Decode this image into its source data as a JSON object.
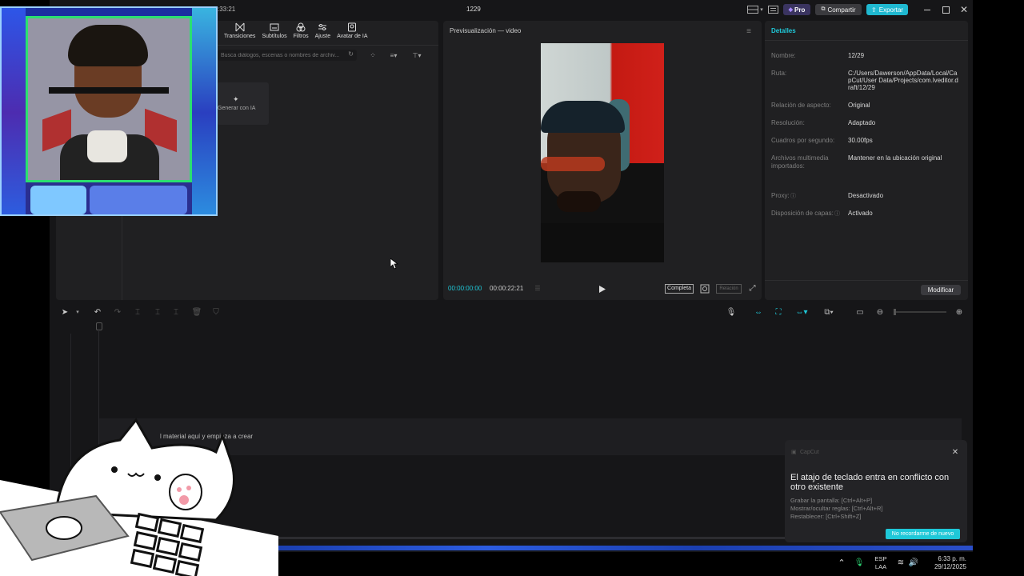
{
  "window": {
    "time_fragment": ":33:21",
    "project_name": "1229"
  },
  "titlebar": {
    "pro_label": "Pro",
    "share_label": "Compartir",
    "export_label": "Exportar"
  },
  "toolbar": {
    "items": [
      "Transiciones",
      "Subtítulos",
      "Filtros",
      "Ajuste",
      "Avatar de IA"
    ]
  },
  "media": {
    "search_placeholder": "Busca diálogos, escenas o nombres de archiv...",
    "ai_card_label": "Generar con IA"
  },
  "preview": {
    "title": "Previsualización — video",
    "current_time": "00:00:00:00",
    "total_time": "00:00:22:21",
    "complete_label": "Completa",
    "ratio_label": "Relación"
  },
  "details": {
    "title": "Detalles",
    "rows": [
      {
        "label": "Nombre:",
        "value": "12/29"
      },
      {
        "label": "Ruta:",
        "value": "C:/Users/Dawerson/AppData/Local/CapCut/User Data/Projects/com.lveditor.draft/12/29"
      },
      {
        "label": "Relación de aspecto:",
        "value": "Original"
      },
      {
        "label": "Resolución:",
        "value": "Adaptado"
      },
      {
        "label": "Cuadros por segundo:",
        "value": "30.00fps"
      },
      {
        "label": "Archivos multimedia importados:",
        "value": "Mantener en la ubicación original"
      },
      {
        "label": "Proxy:",
        "value": "Desactivado"
      },
      {
        "label": "Disposición de capas:",
        "value": "Activado"
      }
    ],
    "modify_label": "Modificar"
  },
  "timeline": {
    "drop_hint": "l material aquí y empieza a crear"
  },
  "toast": {
    "app_name": "CapCut",
    "title": "El atajo de teclado entra en conflicto con otro existente",
    "lines": [
      "Grabar la pantalla: [Ctrl+Alt+P]",
      "Mostrar/ocultar reglas: [Ctrl+Alt+R]",
      "Restablecer: [Ctrl+Shift+Z]"
    ],
    "button": "No recordarme de nuevo"
  },
  "taskbar": {
    "lang_top": "ESP",
    "lang_bottom": "LAA",
    "time": "6:33 p. m.",
    "date": "29/12/2025"
  },
  "colors": {
    "accent": "#1fc8d8",
    "pro": "#6b4ee0",
    "export": "#1fb8d0"
  }
}
